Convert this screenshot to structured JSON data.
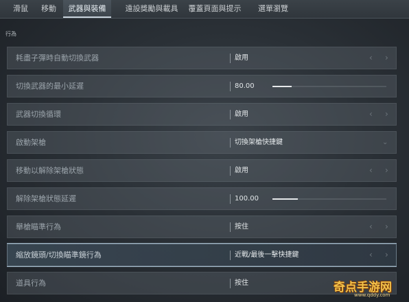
{
  "tabs": [
    {
      "label": "滑鼠"
    },
    {
      "label": "移動"
    },
    {
      "label": "武器與裝備"
    },
    {
      "label": "遠設獎勵與載具"
    },
    {
      "label": "覆蓋頁面與提示"
    },
    {
      "label": "選單瀏覽"
    }
  ],
  "section_title": "行為",
  "rows": [
    {
      "label": "耗盡子彈時自動切換武器",
      "value": "啟用"
    },
    {
      "label": "切換武器的最小延遲",
      "value": "80.00",
      "slider_fraction": 0.17
    },
    {
      "label": "武器切換循環",
      "value": "啟用"
    },
    {
      "label": "啟動架槍",
      "value": "切換架槍快捷鍵"
    },
    {
      "label": "移動以解除架槍狀態",
      "value": "啟用"
    },
    {
      "label": "解除架槍狀態延遲",
      "value": "100.00",
      "slider_fraction": 0.22
    },
    {
      "label": "舉槍瞄準行為",
      "value": "按住"
    },
    {
      "label": "縮放鏡頭/切換瞄準鏡行為",
      "value": "近戰/最後一擊快捷鍵"
    },
    {
      "label": "道具行為",
      "value": "按住"
    }
  ],
  "watermark": {
    "text": "奇点手游网",
    "sub": "www.qddy.com"
  }
}
